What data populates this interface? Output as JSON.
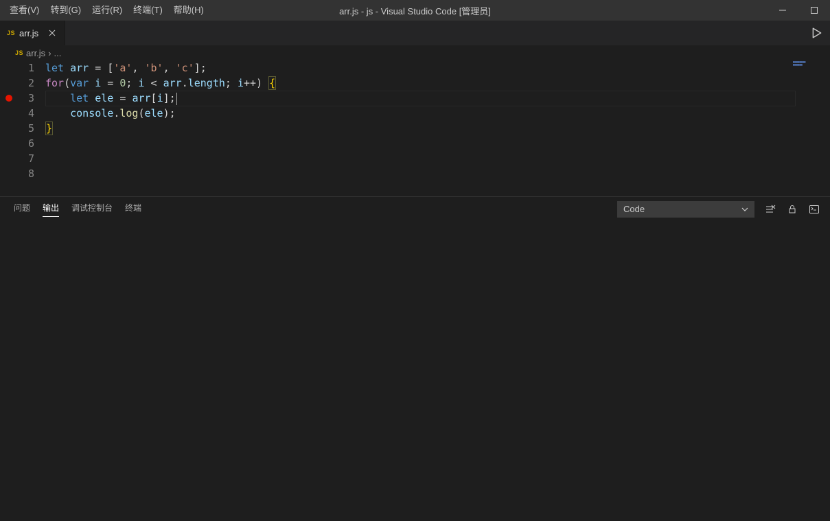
{
  "menu": {
    "items": [
      "查看(V)",
      "转到(G)",
      "运行(R)",
      "终端(T)",
      "帮助(H)"
    ]
  },
  "window": {
    "title": "arr.js - js - Visual Studio Code [管理员]"
  },
  "tabs": [
    {
      "icon_label": "JS",
      "name": "arr.js"
    }
  ],
  "breadcrumb": {
    "icon_label": "JS",
    "file": "arr.js",
    "sep": "›",
    "tail": "..."
  },
  "editor": {
    "lines": [
      {
        "n": 1,
        "bp": false,
        "tokens": [
          [
            "kw",
            "let "
          ],
          [
            "var",
            "arr"
          ],
          [
            "op",
            " = ["
          ],
          [
            "str",
            "'a'"
          ],
          [
            "pun",
            ", "
          ],
          [
            "str",
            "'b'"
          ],
          [
            "pun",
            ", "
          ],
          [
            "str",
            "'c'"
          ],
          [
            "pun",
            "];"
          ]
        ]
      },
      {
        "n": 2,
        "bp": false,
        "tokens": [
          [
            "kw2",
            "for"
          ],
          [
            "pun",
            "("
          ],
          [
            "kw",
            "var "
          ],
          [
            "var",
            "i"
          ],
          [
            "op",
            " = "
          ],
          [
            "num",
            "0"
          ],
          [
            "pun",
            "; "
          ],
          [
            "var",
            "i"
          ],
          [
            "op",
            " < "
          ],
          [
            "var",
            "arr"
          ],
          [
            "pun",
            "."
          ],
          [
            "var",
            "length"
          ],
          [
            "pun",
            "; "
          ],
          [
            "var",
            "i"
          ],
          [
            "op",
            "++"
          ],
          [
            "pun",
            ") "
          ],
          [
            "brc-hl",
            "{"
          ]
        ]
      },
      {
        "n": 3,
        "bp": true,
        "tokens": [
          [
            "op",
            "    "
          ],
          [
            "kw",
            "let "
          ],
          [
            "var",
            "ele"
          ],
          [
            "op",
            " = "
          ],
          [
            "var",
            "arr"
          ],
          [
            "pun",
            "["
          ],
          [
            "var",
            "i"
          ],
          [
            "pun",
            "];"
          ]
        ],
        "caret": true
      },
      {
        "n": 4,
        "bp": false,
        "tokens": [
          [
            "op",
            "    "
          ],
          [
            "var",
            "console"
          ],
          [
            "pun",
            "."
          ],
          [
            "fn",
            "log"
          ],
          [
            "pun",
            "("
          ],
          [
            "var",
            "ele"
          ],
          [
            "pun",
            ");"
          ]
        ]
      },
      {
        "n": 5,
        "bp": false,
        "tokens": [
          [
            "brc-hl",
            "}"
          ]
        ]
      },
      {
        "n": 6,
        "bp": false,
        "tokens": []
      },
      {
        "n": 7,
        "bp": false,
        "tokens": []
      },
      {
        "n": 8,
        "bp": false,
        "tokens": []
      }
    ],
    "active_line": 3
  },
  "panel": {
    "tabs": [
      {
        "label": "问题",
        "active": false
      },
      {
        "label": "输出",
        "active": true
      },
      {
        "label": "调试控制台",
        "active": false
      },
      {
        "label": "终端",
        "active": false
      }
    ],
    "output_select": "Code"
  }
}
